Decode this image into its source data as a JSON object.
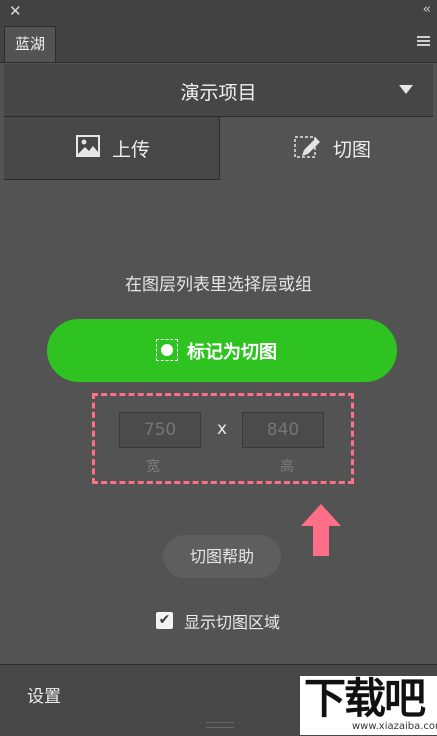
{
  "window": {
    "close_glyph": "✕",
    "collapse_glyph": "‹‹"
  },
  "panel": {
    "tab_label": "蓝湖",
    "menu_icon": "hamburger-menu-icon"
  },
  "project": {
    "name": "演示项目"
  },
  "mode_tabs": {
    "upload_label": "上传",
    "upload_icon": "image-icon",
    "slice_label": "切图",
    "slice_icon": "slice-icon",
    "active": "切图"
  },
  "main": {
    "hint": "在图层列表里选择层或组",
    "mark_button_label": "标记为切图",
    "times_sign": "x",
    "width_placeholder": "750",
    "height_placeholder": "840",
    "width_caption": "宽",
    "height_caption": "高",
    "help_button_label": "切图帮助",
    "show_area_label": "显示切图区域",
    "show_area_checked": true
  },
  "footer": {
    "settings_label": "设置"
  },
  "watermark": {
    "logo_text": "下载吧",
    "url_text": "www.xiazaiba.com"
  },
  "colors": {
    "panel_bg": "#535353",
    "accent_green": "#2ec320",
    "highlight_pink": "#ff6f87"
  }
}
